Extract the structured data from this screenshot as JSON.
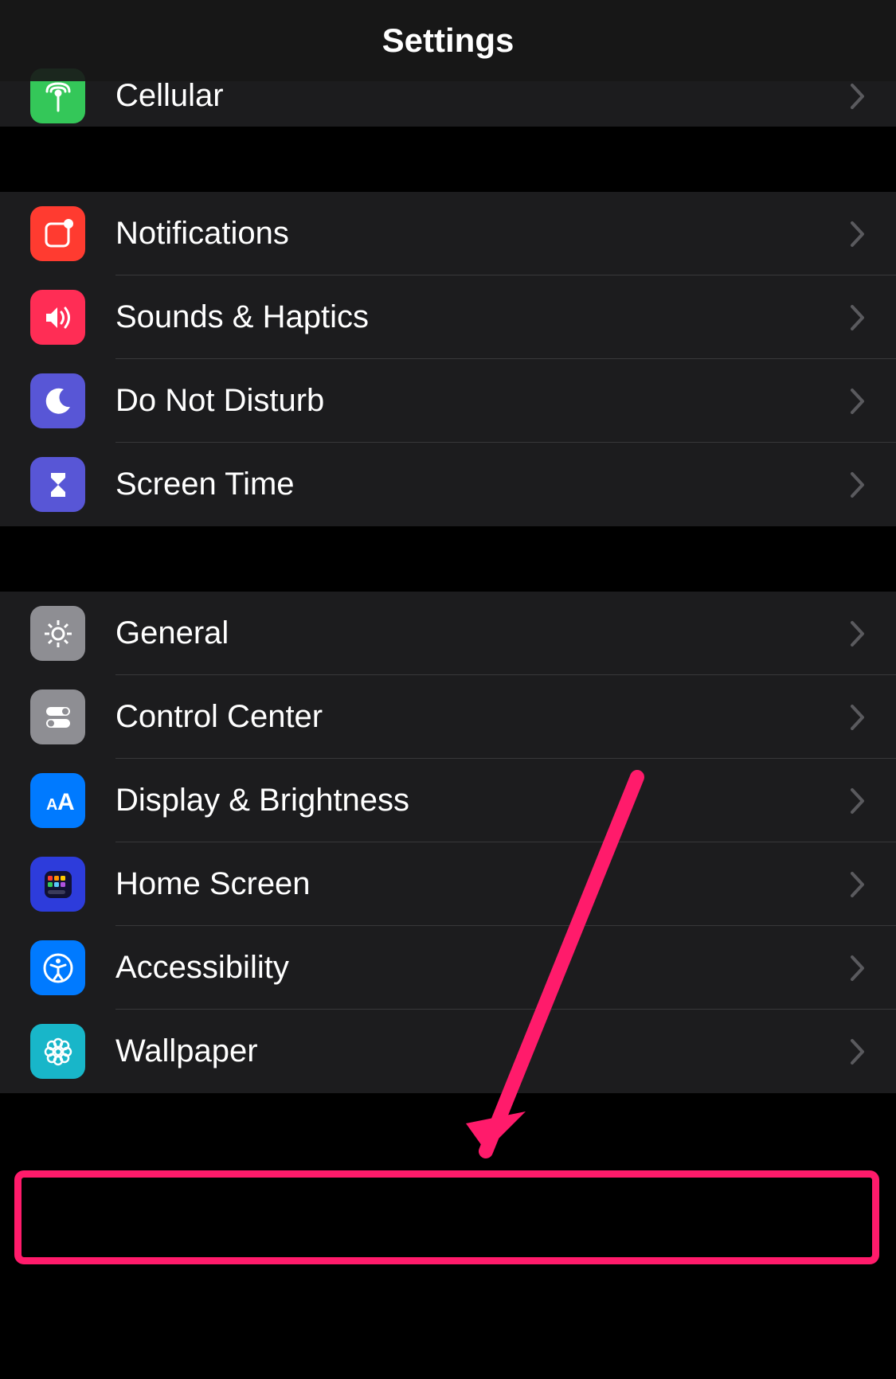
{
  "header": {
    "title": "Settings"
  },
  "groups": [
    {
      "rows": [
        {
          "id": "cellular",
          "label": "Cellular",
          "icon": "antenna-icon",
          "bg": "bg-green",
          "partial": true
        }
      ]
    },
    {
      "rows": [
        {
          "id": "notifications",
          "label": "Notifications",
          "icon": "notifications-icon",
          "bg": "bg-red"
        },
        {
          "id": "sounds",
          "label": "Sounds & Haptics",
          "icon": "speaker-icon",
          "bg": "bg-pink"
        },
        {
          "id": "dnd",
          "label": "Do Not Disturb",
          "icon": "moon-icon",
          "bg": "bg-purple"
        },
        {
          "id": "screentime",
          "label": "Screen Time",
          "icon": "hourglass-icon",
          "bg": "bg-indigo"
        }
      ]
    },
    {
      "rows": [
        {
          "id": "general",
          "label": "General",
          "icon": "gear-icon",
          "bg": "bg-gray"
        },
        {
          "id": "controlcenter",
          "label": "Control Center",
          "icon": "toggles-icon",
          "bg": "bg-gray"
        },
        {
          "id": "display",
          "label": "Display & Brightness",
          "icon": "text-size-icon",
          "bg": "bg-blue"
        },
        {
          "id": "homescreen",
          "label": "Home Screen",
          "icon": "grid-icon",
          "bg": "bg-darkblue"
        },
        {
          "id": "accessibility",
          "label": "Accessibility",
          "icon": "accessibility-icon",
          "bg": "bg-blue",
          "highlighted": true
        },
        {
          "id": "wallpaper",
          "label": "Wallpaper",
          "icon": "flower-icon",
          "bg": "bg-cyan"
        }
      ]
    }
  ],
  "annotation": {
    "highlight_target": "accessibility",
    "arrow_color": "#ff1b6b"
  }
}
